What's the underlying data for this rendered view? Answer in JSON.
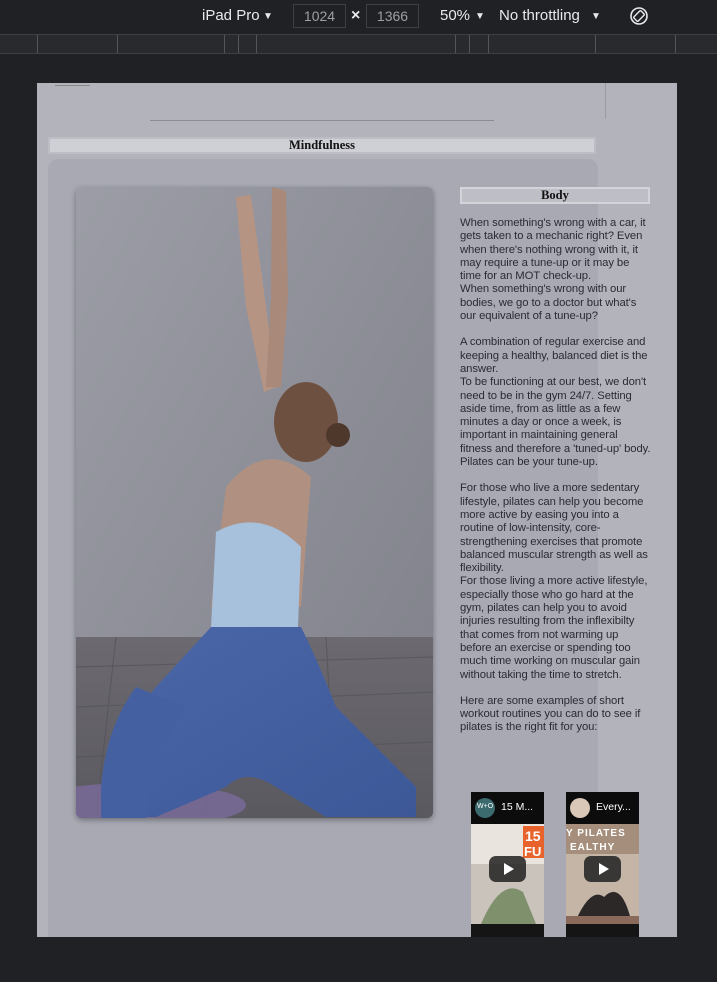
{
  "devtools": {
    "device": "iPad Pro",
    "width": "1024",
    "height": "1366",
    "times": "×",
    "zoom": "50%",
    "throttling": "No throttling",
    "dropdown_icon": "caret-down-icon",
    "rotate_icon": "rotate-icon"
  },
  "page": {
    "section_title": "Mindfulness",
    "body_title": "Body",
    "paragraphs": [
      "When something's wrong with a car, it gets taken to a mechanic right? Even when there's nothing wrong with it, it may require a tune-up or it may be time for an MOT check-up.",
      "When something's wrong with our bodies, we go to a doctor but what's our equivalent of a tune-up?",
      "A combination of regular exercise and keeping a healthy, balanced diet is the answer.",
      "To be functioning at our best, we don't need to be in the gym 24/7. Setting aside time, from as little as a few minutes a day or once a week, is important in maintaining general fitness and therefore a 'tuned-up' body. Pilates can be your tune-up.",
      "For those who live a more sedentary lifestyle, pilates can help you become more active by easing you into a routine of low-intensity, core-strengthening exercises that promote balanced muscular strength as well as flexibility.",
      "For those living a more active lifestyle, especially those who go hard at the gym, pilates can help you to avoid injuries resulting from the inflexibilty that comes from not warming up before an exercise or spending too much time working on muscular gain without taking the time to stretch.",
      "Here are some examples of short workout routines you can do to see if pilates is the right fit for you:"
    ],
    "videos": [
      {
        "title": "15 M...",
        "avatar_text": "W+O",
        "overlay_text": "15",
        "overlay_text2": "FU"
      },
      {
        "title": "Every...",
        "overlay_text": "Y PILATES",
        "overlay_text2": "EALTHY"
      }
    ]
  },
  "colors": {
    "page_bg": "#b3b3bc",
    "card_bg": "#a8a9b3",
    "toolbar_bg": "#202124"
  }
}
